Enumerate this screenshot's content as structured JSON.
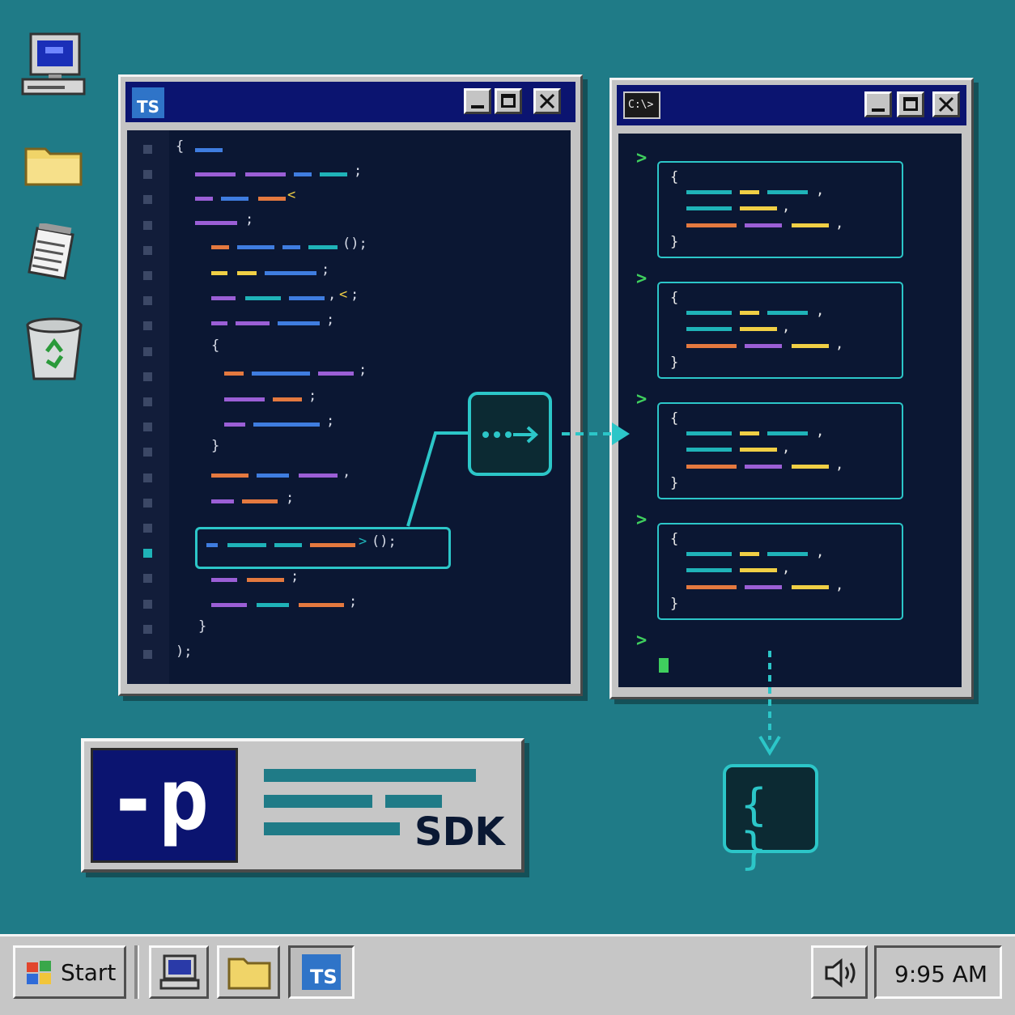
{
  "desktop": {
    "icons": [
      "my-computer-icon",
      "folder-icon",
      "notepad-icon",
      "recycle-bin-icon"
    ]
  },
  "editor_window": {
    "title_badge": "TS",
    "controls": [
      "minimize",
      "maximize",
      "close"
    ],
    "code_symbols": {
      "open_brace": "{",
      "close_brace": "}",
      "close_call": ");",
      "semicolon": ";",
      "comma": ",",
      "call_parens": "();",
      "angle": "<",
      "arrow": ">"
    }
  },
  "terminal_window": {
    "title_badge": "C:\\>",
    "controls": [
      "minimize",
      "maximize",
      "close"
    ],
    "prompt_symbol": ">",
    "output_blocks": 4,
    "brace_open": "{",
    "brace_close": "}"
  },
  "run_node": {
    "label": "•••→"
  },
  "json_result": {
    "label": "{ }"
  },
  "logo": {
    "mark": "-p",
    "text": "SDK"
  },
  "taskbar": {
    "start_label": "Start",
    "apps": [
      "computer",
      "folder",
      "TS"
    ],
    "ts_label": "TS",
    "clock": "9:95 AM"
  },
  "colors": {
    "desktop": "#1f7b87",
    "titlebar": "#0b1470",
    "pane": "#0b1733",
    "accent": "#2cc6c8",
    "purple": "#9b5fd6",
    "blue": "#3f7de0",
    "cyan": "#1fb3b8",
    "orange": "#e4793f",
    "yellow": "#f0cf45",
    "green": "#3fcf5e"
  }
}
